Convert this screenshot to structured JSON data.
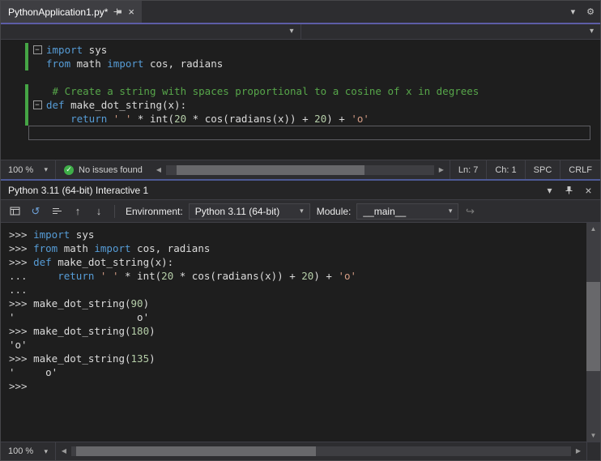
{
  "colors": {
    "keyword": "#569cd6",
    "comment": "#57a64a",
    "string": "#d69d85",
    "number": "#b5cea8",
    "default_text": "#dcdcdc",
    "tab_accent": "#5d5da6",
    "panel_accent": "#4d5a96",
    "change_bar_green": "#45a545",
    "issues_check_green": "#3fae49",
    "editor_background": "#1e1e1e"
  },
  "tab": {
    "title": "PythonApplication1.py*"
  },
  "editor": {
    "lines": [
      {
        "collapse": true,
        "changed": true,
        "tokens": [
          [
            "k",
            "import"
          ],
          [
            "t",
            " sys"
          ]
        ]
      },
      {
        "changed": true,
        "tokens": [
          [
            "k",
            "from"
          ],
          [
            "t",
            " math "
          ],
          [
            "k",
            "import"
          ],
          [
            "t",
            " cos, radians"
          ]
        ]
      },
      {
        "tokens": []
      },
      {
        "changed": true,
        "tokens": [
          [
            "t",
            " "
          ],
          [
            "c",
            "# Create a string with spaces proportional to a cosine of x in degrees"
          ]
        ]
      },
      {
        "collapse": true,
        "changed": true,
        "tokens": [
          [
            "k",
            "def"
          ],
          [
            "t",
            " make_dot_string(x):"
          ]
        ]
      },
      {
        "changed": true,
        "tokens": [
          [
            "t",
            "    "
          ],
          [
            "k",
            "return"
          ],
          [
            "t",
            " "
          ],
          [
            "s",
            "' '"
          ],
          [
            "t",
            " * int("
          ],
          [
            "n",
            "20"
          ],
          [
            "t",
            " * cos(radians(x)) + "
          ],
          [
            "n",
            "20"
          ],
          [
            "t",
            ") + "
          ],
          [
            "s",
            "'o'"
          ]
        ]
      },
      {
        "current": true,
        "tokens": []
      }
    ]
  },
  "editor_status": {
    "zoom": "100 %",
    "issues_text": "No issues found",
    "line": "Ln: 7",
    "column": "Ch: 1",
    "space_mode": "SPC",
    "line_ending": "CRLF"
  },
  "interactive": {
    "title": "Python 3.11 (64-bit) Interactive 1",
    "environment_label": "Environment:",
    "environment_value": "Python 3.11 (64-bit)",
    "module_label": "Module:",
    "module_value": "__main__",
    "zoom": "100 %",
    "lines": [
      {
        "tokens": [
          [
            "p",
            ">>> "
          ],
          [
            "k",
            "import"
          ],
          [
            "t",
            " sys"
          ]
        ]
      },
      {
        "tokens": [
          [
            "p",
            ">>> "
          ],
          [
            "k",
            "from"
          ],
          [
            "t",
            " math "
          ],
          [
            "k",
            "import"
          ],
          [
            "t",
            " cos, radians"
          ]
        ]
      },
      {
        "tokens": [
          [
            "p",
            ">>> "
          ],
          [
            "k",
            "def"
          ],
          [
            "t",
            " make_dot_string(x):"
          ]
        ]
      },
      {
        "tokens": [
          [
            "p",
            "... "
          ],
          [
            "t",
            "    "
          ],
          [
            "k",
            "return"
          ],
          [
            "t",
            " "
          ],
          [
            "s",
            "' '"
          ],
          [
            "t",
            " * int("
          ],
          [
            "n",
            "20"
          ],
          [
            "t",
            " * cos(radians(x)) + "
          ],
          [
            "n",
            "20"
          ],
          [
            "t",
            ") + "
          ],
          [
            "s",
            "'o'"
          ]
        ]
      },
      {
        "tokens": [
          [
            "p",
            "..."
          ]
        ]
      },
      {
        "tokens": [
          [
            "p",
            ">>> "
          ],
          [
            "t",
            "make_dot_string("
          ],
          [
            "n",
            "90"
          ],
          [
            "t",
            ")"
          ]
        ]
      },
      {
        "tokens": [
          [
            "t",
            "'                    o'"
          ]
        ]
      },
      {
        "tokens": [
          [
            "p",
            ">>> "
          ],
          [
            "t",
            "make_dot_string("
          ],
          [
            "n",
            "180"
          ],
          [
            "t",
            ")"
          ]
        ]
      },
      {
        "tokens": [
          [
            "t",
            "'o'"
          ]
        ]
      },
      {
        "tokens": [
          [
            "p",
            ">>> "
          ],
          [
            "t",
            "make_dot_string("
          ],
          [
            "n",
            "135"
          ],
          [
            "t",
            ")"
          ]
        ]
      },
      {
        "tokens": [
          [
            "t",
            "'     o'"
          ]
        ]
      },
      {
        "tokens": [
          [
            "p",
            ">>>"
          ]
        ]
      }
    ]
  },
  "icons": {
    "chevron_down": "▾",
    "close": "×",
    "gear": "⚙",
    "check": "✓",
    "scroll_left": "◀",
    "scroll_right": "▶",
    "scroll_up": "▲",
    "scroll_down": "▼",
    "history_prev": "↑",
    "history_next": "↓",
    "reset": "↺",
    "send": "↪",
    "collapse_box": "−"
  }
}
